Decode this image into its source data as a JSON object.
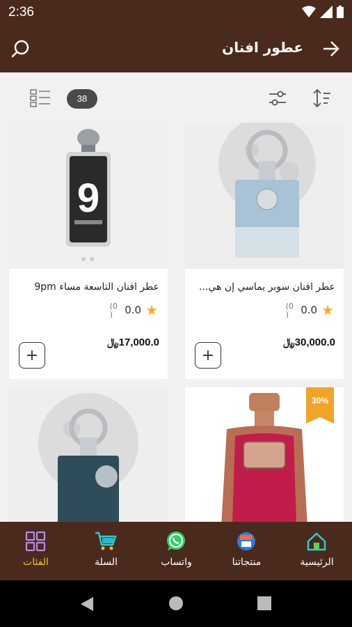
{
  "status_bar": {
    "time": "2:36"
  },
  "app_bar": {
    "title": "عطور افنان",
    "search_icon": "search-icon",
    "back_icon": "arrow-right-icon"
  },
  "toolbar": {
    "result_count": "38",
    "view_icon": "list-view-icon",
    "filter_icon": "filter-sliders-icon",
    "sort_icon": "sort-icon"
  },
  "products": [
    {
      "name": "عطر افنان سوبر يماسي إن هي...",
      "rating": "0.0",
      "rating_count": "(0",
      "rating_count2": ")",
      "price": "30,000.0",
      "currency": "﷼",
      "add_label": "+"
    },
    {
      "name": "عطر افنان التاسعة مساء 9pm",
      "rating": "0.0",
      "rating_count": "(0",
      "rating_count2": ")",
      "price": "17,000.0",
      "currency": "﷼",
      "add_label": "+"
    },
    {
      "discount": "30%"
    },
    {}
  ],
  "bottom_nav": {
    "items": [
      {
        "label": "الرئيسية",
        "icon": "home-icon"
      },
      {
        "label": "منتجاتنا",
        "icon": "products-shop-icon"
      },
      {
        "label": "واتساب",
        "icon": "whatsapp-icon"
      },
      {
        "label": "السلة",
        "icon": "cart-icon"
      },
      {
        "label": "الفئات",
        "icon": "categories-grid-icon"
      }
    ]
  },
  "colors": {
    "brand_brown": "#4a2a1c",
    "accent_gold": "#f0c12b",
    "star": "#f2b31b",
    "discount": "#f2a32b"
  }
}
